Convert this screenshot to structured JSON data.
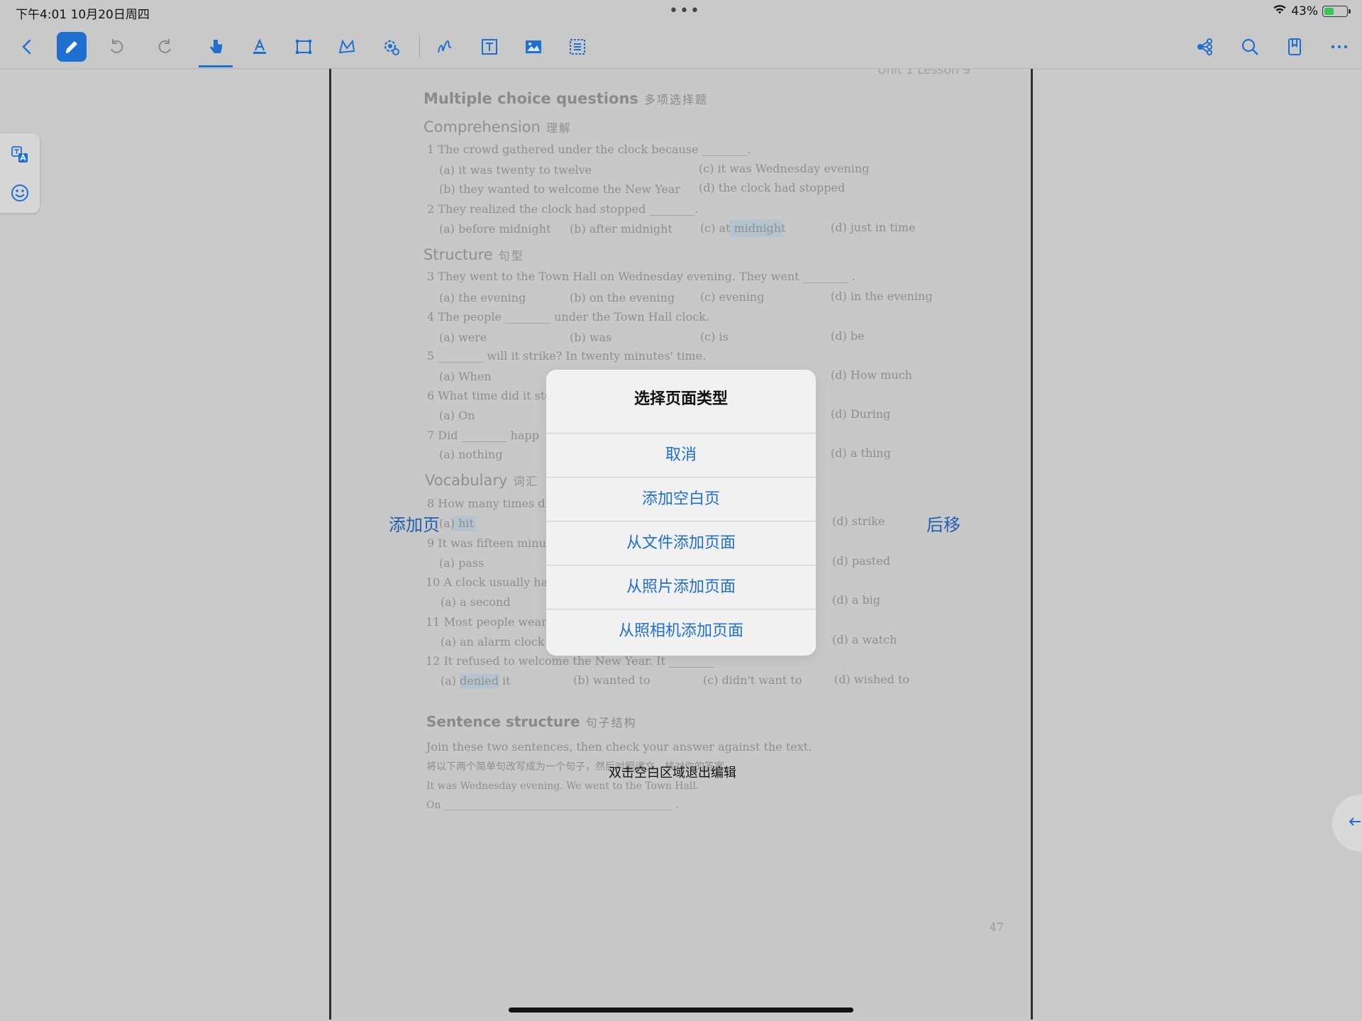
{
  "status_bar": {
    "time_date": "下午4:01   10月20日周四",
    "dots": "•••",
    "battery_percent": "43%",
    "battery_level": 0.43
  },
  "toolbar": {
    "left_icons": [
      "back-icon",
      "pen-icon",
      "undo-icon",
      "redo-icon",
      "hand-pointer-icon",
      "text-highlight-icon",
      "rectangle-select-icon",
      "lasso-icon",
      "settings-icon",
      "stroke-icon",
      "text-box-icon",
      "image-icon",
      "ocr-icon"
    ],
    "right_icons": [
      "share-icon",
      "search-icon",
      "bookmark-icon",
      "more-icon"
    ],
    "accent": "#1f6fd1"
  },
  "side_panel": {
    "icons": [
      "translate-icon",
      "sticker-icon"
    ]
  },
  "page": {
    "header": "Unit 1    Lesson 9",
    "mcq_title": "Multiple choice questions",
    "mcq_title_cn": "多项选择题",
    "comprehension": "Comprehension",
    "comprehension_cn": "理解",
    "q1": "1  The crowd gathered under the clock because ________.",
    "q1a": "(a) it was twenty to twelve",
    "q1c": "(c) it was Wednesday evening",
    "q1b": "(b) they wanted to welcome the New Year",
    "q1d": "(d) the clock had stopped",
    "q2": "2  They realized the clock had stopped ________.",
    "q2a": "(a) before midnight",
    "q2b": "(b) after midnight",
    "q2c": "(c) at midnight",
    "q2d": "(d) just in time",
    "structure": "Structure",
    "structure_cn": "句型",
    "q3": "3  They went to the Town Hall on Wednesday evening. They went ________ .",
    "q3a": "(a) the evening",
    "q3b": "(b) on the evening",
    "q3c": "(c) evening",
    "q3d": "(d) in the evening",
    "q4": "4  The people ________ under the Town Hall clock.",
    "q4a": "(a) were",
    "q4b": "(b) was",
    "q4c": "(c) is",
    "q4d": "(d) be",
    "q5": "5  ________ will it strike? In twenty minutes' time.",
    "q5a": "(a) When",
    "q5d": "(d) How much",
    "q6": "6  What time did it sto",
    "q6a": "(a) On",
    "q6d": "(d) During",
    "q7": "7  Did ________ happ",
    "q7a": "(a) nothing",
    "q7d": "(d) a thing",
    "vocabulary": "Vocabulary",
    "vocabulary_cn": "词汇",
    "q8": "8  How many times di",
    "q8a": "(a) hit",
    "q8d": "(d) strike",
    "q9": "9  It was fifteen minu",
    "q9a": "(a) pass",
    "q9d": "(d) pasted",
    "q10": "10  A clock usually has",
    "q10a": "(a) a second",
    "q10d": "(d) a big",
    "q11": "11  Most people wear o",
    "q11a": "(a) an alarm clock",
    "q11d": "(d) a watch",
    "q12": "12  It refused to welcome the New Year. It ________",
    "q12a": "(a) denied it",
    "q12b": "(b) wanted to",
    "q12c": "(c) didn't want to",
    "q12d": "(d) wished to",
    "sentence": "Sentence structure",
    "sentence_cn": "句子结构",
    "join": "Join these two sentences, then check your answer against the text.",
    "join_cn": "将以下两个简单句改写成为一个句子，然后对照课文，核对你的答案。",
    "example": "It was Wednesday evening. We went to the Town Hall.",
    "on_line": "On ______________________________________________ .",
    "page_number": "47"
  },
  "labels": {
    "add_page": "添加页",
    "move_back": "后移"
  },
  "dialog": {
    "title": "选择页面类型",
    "options": [
      "取消",
      "添加空白页",
      "从文件添加页面",
      "从照片添加页面",
      "从照相机添加页面"
    ]
  },
  "hint": "双击空白区域退出编辑"
}
